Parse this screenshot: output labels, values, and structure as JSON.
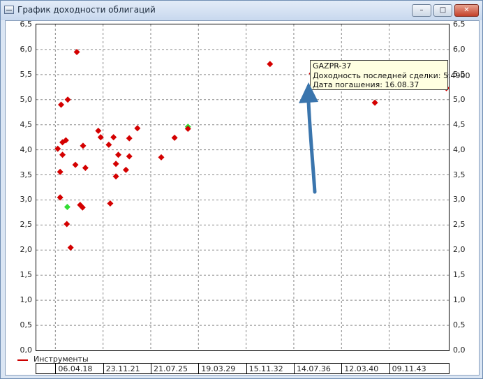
{
  "window": {
    "title": "График доходности облигаций",
    "icon": "app-window-icon",
    "controls": {
      "minimize": "–",
      "maximize": "□",
      "close": "✕"
    }
  },
  "legend": {
    "label": "Инструменты",
    "color": "#cc0000"
  },
  "tooltip": {
    "name": "GAZPR-37",
    "yield_line": "Доходность последней сделки: 5,4900",
    "date_line": "Дата погашения: 16.08.37"
  },
  "annotation": {
    "arrow_color": "#3a75ad",
    "arrow_icon": "arrow-up-icon"
  },
  "chart_data": {
    "type": "scatter",
    "y_ticks": [
      "0,0",
      "0,5",
      "1,0",
      "1,5",
      "2,0",
      "2,5",
      "3,0",
      "3,5",
      "4,0",
      "4,5",
      "5,0",
      "5,5",
      "6,0",
      "6,5"
    ],
    "x_ticks": [
      "06.04.18",
      "23.11.21",
      "21.07.25",
      "19.03.29",
      "15.11.32",
      "14.07.36",
      "12.03.40",
      "09.11.43"
    ],
    "ylim": [
      0,
      6.5
    ],
    "xlim": [
      -0.4,
      8.25
    ],
    "grid": true,
    "colors": {
      "default": "#d40000",
      "highlight": "#33dd33"
    },
    "points": [
      {
        "x": 0.05,
        "y": 4.02
      },
      {
        "x": 0.1,
        "y": 3.56
      },
      {
        "x": 0.1,
        "y": 3.05
      },
      {
        "x": 0.12,
        "y": 4.9
      },
      {
        "x": 0.15,
        "y": 4.15
      },
      {
        "x": 0.15,
        "y": 3.9
      },
      {
        "x": 0.22,
        "y": 4.19
      },
      {
        "x": 0.24,
        "y": 2.52
      },
      {
        "x": 0.26,
        "y": 5.0
      },
      {
        "x": 0.32,
        "y": 2.05
      },
      {
        "x": 0.42,
        "y": 3.7
      },
      {
        "x": 0.45,
        "y": 5.95
      },
      {
        "x": 0.52,
        "y": 2.9
      },
      {
        "x": 0.57,
        "y": 2.85
      },
      {
        "x": 0.58,
        "y": 4.08
      },
      {
        "x": 0.63,
        "y": 3.64
      },
      {
        "x": 0.9,
        "y": 4.38
      },
      {
        "x": 0.95,
        "y": 4.25
      },
      {
        "x": 1.12,
        "y": 4.1
      },
      {
        "x": 1.15,
        "y": 2.93
      },
      {
        "x": 1.22,
        "y": 4.25
      },
      {
        "x": 1.27,
        "y": 3.72
      },
      {
        "x": 1.27,
        "y": 3.47
      },
      {
        "x": 1.32,
        "y": 3.9
      },
      {
        "x": 1.48,
        "y": 3.6
      },
      {
        "x": 1.55,
        "y": 3.87
      },
      {
        "x": 1.55,
        "y": 4.23
      },
      {
        "x": 1.72,
        "y": 4.43
      },
      {
        "x": 2.22,
        "y": 3.85
      },
      {
        "x": 2.5,
        "y": 4.24
      },
      {
        "x": 2.78,
        "y": 4.42
      },
      {
        "x": 4.5,
        "y": 5.71
      },
      {
        "x": 5.38,
        "y": 5.52
      },
      {
        "x": 6.7,
        "y": 4.94
      },
      {
        "x": 8.2,
        "y": 5.23
      }
    ],
    "highlight_points": [
      {
        "x": 0.25,
        "y": 2.86
      },
      {
        "x": 2.78,
        "y": 4.46
      }
    ]
  }
}
